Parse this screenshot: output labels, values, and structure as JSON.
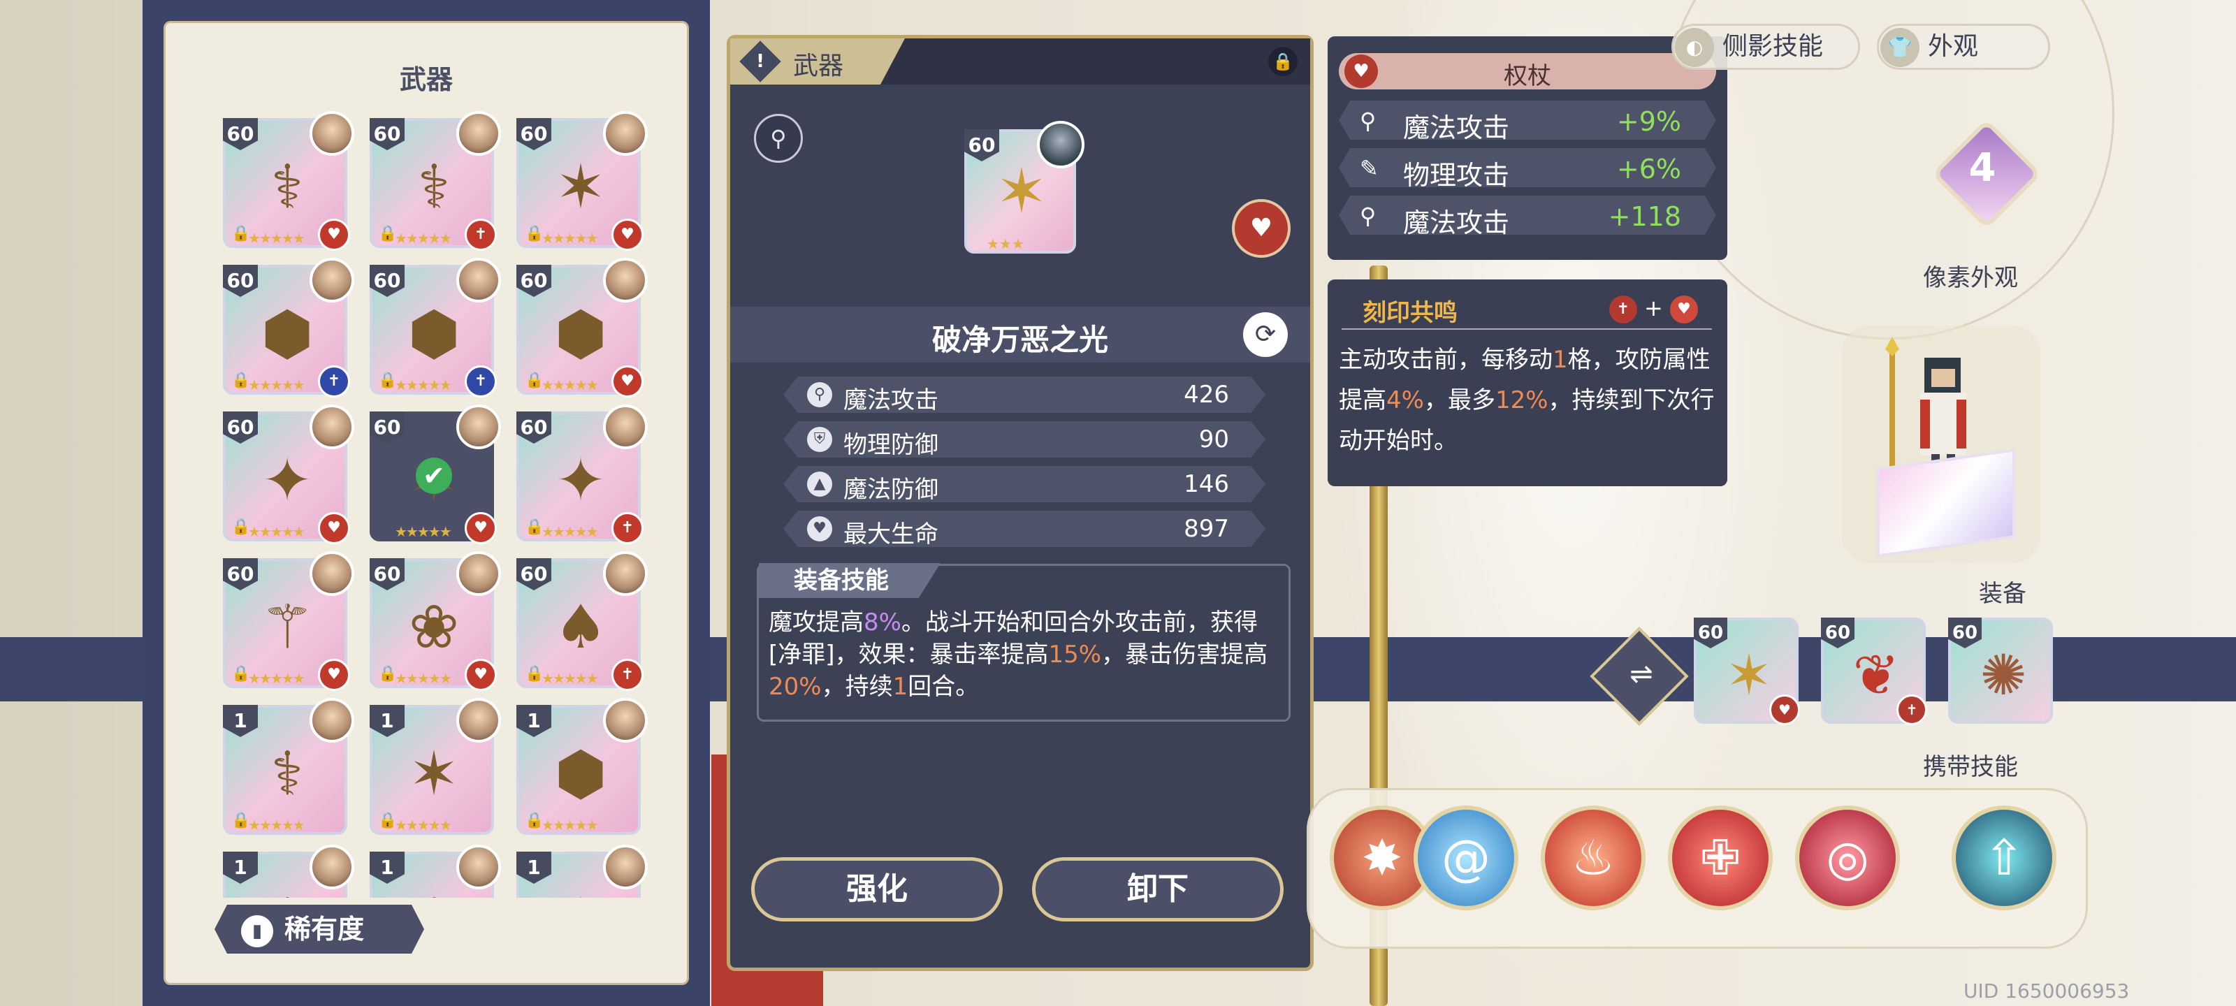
{
  "left_panel": {
    "title": "武器",
    "rarity_label": "稀有度",
    "cards": [
      {
        "level": "60",
        "badge": "♥",
        "badge_color": "red",
        "weapon": "⚕",
        "locked": true
      },
      {
        "level": "60",
        "badge": "✝",
        "badge_color": "red",
        "weapon": "⚕",
        "locked": true
      },
      {
        "level": "60",
        "badge": "♥",
        "badge_color": "red",
        "weapon": "✶",
        "locked": true
      },
      {
        "level": "60",
        "badge": "✝",
        "badge_color": "blue",
        "weapon": "⬢",
        "locked": true
      },
      {
        "level": "60",
        "badge": "✝",
        "badge_color": "blue",
        "weapon": "⬢",
        "locked": true
      },
      {
        "level": "60",
        "badge": "♥",
        "badge_color": "red",
        "weapon": "⬢",
        "locked": true
      },
      {
        "level": "60",
        "badge": "♥",
        "badge_color": "red",
        "weapon": "✦",
        "locked": true
      },
      {
        "level": "60",
        "badge": "♥",
        "badge_color": "red",
        "weapon": "✶",
        "locked": false,
        "selected": true
      },
      {
        "level": "60",
        "badge": "✝",
        "badge_color": "red",
        "weapon": "✦",
        "locked": true
      },
      {
        "level": "60",
        "badge": "♥",
        "badge_color": "red",
        "weapon": "⚚",
        "locked": true
      },
      {
        "level": "60",
        "badge": "♥",
        "badge_color": "red",
        "weapon": "❀",
        "locked": true
      },
      {
        "level": "60",
        "badge": "✝",
        "badge_color": "red",
        "weapon": "♠",
        "locked": true
      },
      {
        "level": "1",
        "badge": "",
        "badge_color": "",
        "weapon": "⚕",
        "locked": true
      },
      {
        "level": "1",
        "badge": "",
        "badge_color": "",
        "weapon": "✶",
        "locked": true
      },
      {
        "level": "1",
        "badge": "",
        "badge_color": "",
        "weapon": "⬢",
        "locked": true
      },
      {
        "level": "1",
        "badge": "",
        "badge_color": "",
        "weapon": "⚕",
        "locked": false
      },
      {
        "level": "1",
        "badge": "",
        "badge_color": "",
        "weapon": "⚚",
        "locked": false
      },
      {
        "level": "1",
        "badge": "",
        "badge_color": "",
        "weapon": "✶",
        "locked": false
      }
    ]
  },
  "detail": {
    "tab_label": "武器",
    "level": "60",
    "weapon_name": "破净万恶之光",
    "stats": [
      {
        "icon": "⚲",
        "label": "魔法攻击",
        "value": "426"
      },
      {
        "icon": "⛨",
        "label": "物理防御",
        "value": "90"
      },
      {
        "icon": "▲",
        "label": "魔法防御",
        "value": "146"
      },
      {
        "icon": "♥",
        "label": "最大生命",
        "value": "897"
      }
    ],
    "skill_tag": "装备技能",
    "skill_parts": [
      {
        "text": "魔攻提高",
        "cls": ""
      },
      {
        "text": "8%",
        "cls": "purple"
      },
      {
        "text": "。战斗开始和回合外攻击前，获得[净罪]，效果：暴击率提高",
        "cls": ""
      },
      {
        "text": "15%",
        "cls": "orange"
      },
      {
        "text": "，暴击伤害提高",
        "cls": ""
      },
      {
        "text": "20%",
        "cls": "orange"
      },
      {
        "text": "，持续",
        "cls": ""
      },
      {
        "text": "1",
        "cls": "orange"
      },
      {
        "text": "回合。",
        "cls": ""
      }
    ],
    "enhance_button": "强化",
    "unequip_button": "卸下"
  },
  "scepter": {
    "type_label": "权杖",
    "substats": [
      {
        "icon": "⚲",
        "label": "魔法攻击",
        "value": "+9%"
      },
      {
        "icon": "✎",
        "label": "物理攻击",
        "value": "+6%"
      },
      {
        "icon": "⚲",
        "label": "魔法攻击",
        "value": "+118"
      }
    ]
  },
  "resonance": {
    "title": "刻印共鸣",
    "plus": "+",
    "parts": [
      {
        "text": "主动攻击前，每移动",
        "cls": ""
      },
      {
        "text": "1",
        "cls": "orange"
      },
      {
        "text": "格，攻防属性提高",
        "cls": ""
      },
      {
        "text": "4%",
        "cls": "orange"
      },
      {
        "text": "，最多",
        "cls": ""
      },
      {
        "text": "12%",
        "cls": "orange"
      },
      {
        "text": "，持续到下次行动开始时。",
        "cls": ""
      }
    ]
  },
  "right": {
    "top_buttons": [
      "侧影技能",
      "外观"
    ],
    "level_value": "4",
    "pixel_label": "像素外观",
    "equip_label": "装备",
    "equip_levels": [
      "60",
      "60",
      "60"
    ],
    "skills_label": "携带技能",
    "uid": "UID 1650006953"
  },
  "colors": {
    "panel_dark": "#3d4156",
    "gold_border": "#bda66e",
    "green_value": "#8fe05a",
    "accent_red": "#b33a2f"
  }
}
